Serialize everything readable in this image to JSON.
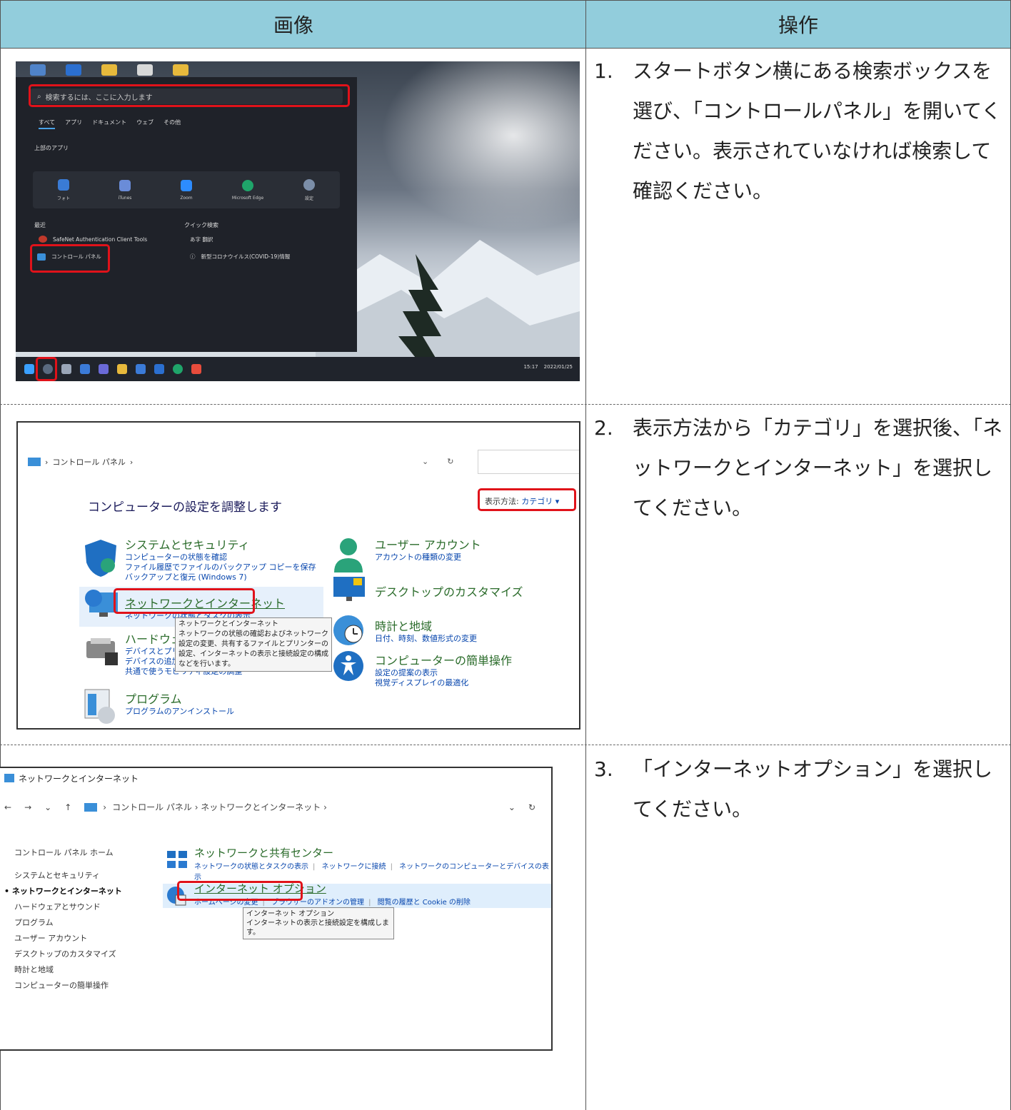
{
  "header": {
    "image_col": "画像",
    "op_col": "操作"
  },
  "steps": [
    {
      "num": "1.",
      "text": "スタートボタン横にある検索ボックスを選び、「コントロールパネル」を開いてください。表示されていなければ検索して確認ください。"
    },
    {
      "num": "2.",
      "text": "表示方法から「カテゴリ」を選択後、「ネットワークとインターネット」を選択してください。"
    },
    {
      "num": "3.",
      "text": "「インターネットオプション」を選択してください。"
    }
  ],
  "startmenu": {
    "search_placeholder": "検索するには、ここに入力します",
    "tabs": [
      "すべて",
      "アプリ",
      "ドキュメント",
      "ウェブ",
      "その他"
    ],
    "pinned_heading": "上部のアプリ",
    "apps": [
      "フォト",
      "iTunes",
      "Zoom",
      "Microsoft Edge",
      "設定"
    ],
    "recent_heading": "最近",
    "quick_heading": "クイック検索",
    "recent": [
      "SafeNet Authentication Client Tools",
      "コントロール パネル"
    ],
    "quick": [
      "あ字 翻訳",
      "新型コロナウイルス(COVID-19)情報"
    ],
    "clock_time": "15:17",
    "clock_date": "2022/01/25"
  },
  "controlpanel": {
    "breadcrumb": "コントロール パネル",
    "title": "コンピューターの設定を調整します",
    "viewby_label": "表示方法:",
    "viewby_value": "カテゴリ ▾",
    "categories": [
      {
        "title": "システムとセキュリティ",
        "links": [
          "コンピューターの状態を確認",
          "ファイル履歴でファイルのバックアップ コピーを保存",
          "バックアップと復元 (Windows 7)"
        ]
      },
      {
        "title": "ネットワークとインターネット",
        "links": [
          "ネットワークの状態とタスクの表示"
        ]
      },
      {
        "title": "ハードウェアとサウンド",
        "links": [
          "デバイスとプリンターの表示",
          "デバイスの追加",
          "共通で使うモビリティ設定の調整"
        ]
      },
      {
        "title": "プログラム",
        "links": [
          "プログラムのアンインストール"
        ]
      },
      {
        "title": "ユーザー アカウント",
        "links": [
          "アカウントの種類の変更"
        ]
      },
      {
        "title": "デスクトップのカスタマイズ",
        "links": []
      },
      {
        "title": "時計と地域",
        "links": [
          "日付、時刻、数値形式の変更"
        ]
      },
      {
        "title": "コンピューターの簡単操作",
        "links": [
          "設定の提案の表示",
          "視覚ディスプレイの最適化"
        ]
      }
    ],
    "tooltip": [
      "ネットワークとインターネット",
      "ネットワークの状態の確認およびネットワーク設定の変更、共有するファイルとプリンターの設定、インターネットの表示と接続設定の構成などを行います。"
    ]
  },
  "network": {
    "window_title": "ネットワークとインターネット",
    "breadcrumb": "コントロール パネル  ›  ネットワークとインターネット  ›",
    "sidebar": [
      "コントロール パネル ホーム",
      "システムとセキュリティ",
      "ネットワークとインターネット",
      "ハードウェアとサウンド",
      "プログラム",
      "ユーザー アカウント",
      "デスクトップのカスタマイズ",
      "時計と地域",
      "コンピューターの簡単操作"
    ],
    "sharing_title": "ネットワークと共有センター",
    "sharing_links": [
      "ネットワークの状態とタスクの表示",
      "ネットワークに接続",
      "ネットワークのコンピューターとデバイスの表示"
    ],
    "inet_title": "インターネット オプション",
    "inet_links": [
      "ホームページの変更",
      "ブラウザーのアドオンの管理",
      "閲覧の履歴と Cookie の削除"
    ],
    "tooltip": [
      "インターネット オプション",
      "インターネットの表示と接続設定を構成します。"
    ]
  }
}
